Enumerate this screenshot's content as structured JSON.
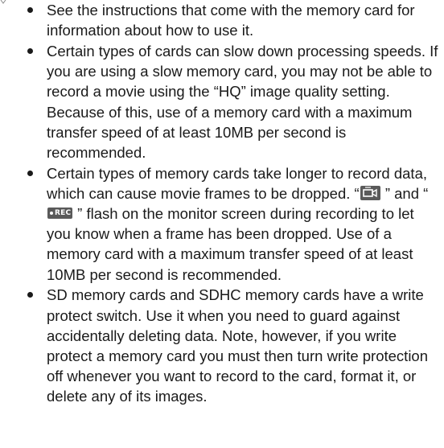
{
  "bullets": {
    "b1": {
      "text": "See the instructions that come with the memory card for information about how to use it."
    },
    "b2": {
      "text": "Certain types of cards can slow down processing speeds. If you are using a slow memory card, you may not be able to record a movie using the “HQ” image quality setting. Because of this, use of a memory card with a maximum transfer speed of at least 10MB per second is recommended."
    },
    "b3": {
      "text_before_icon1": "Certain types of memory cards take longer to record data, which can cause movie frames to be dropped. “",
      "icon1": "movie-camera-icon",
      "text_between_icons": " ” and “",
      "icon2": "rec-indicator-icon",
      "icon2_label": "REC",
      "text_after_icon2": " ” flash on the monitor screen during recording to let you know when a frame has been dropped. Use of a memory card with a maximum transfer speed of at least 10MB per second is recommended."
    },
    "b4": {
      "text": "SD memory cards and SDHC memory cards have a write protect switch. Use it when you need to guard against accidentally deleting data. Note, however, if you write protect a memory card you must then turn write protection off whenever you want to record to the card, format it, or delete any of its images."
    }
  },
  "colors": {
    "text": "#1a1a1a",
    "icon_background": "#5a5a5a",
    "icon_foreground": "#ffffff"
  }
}
